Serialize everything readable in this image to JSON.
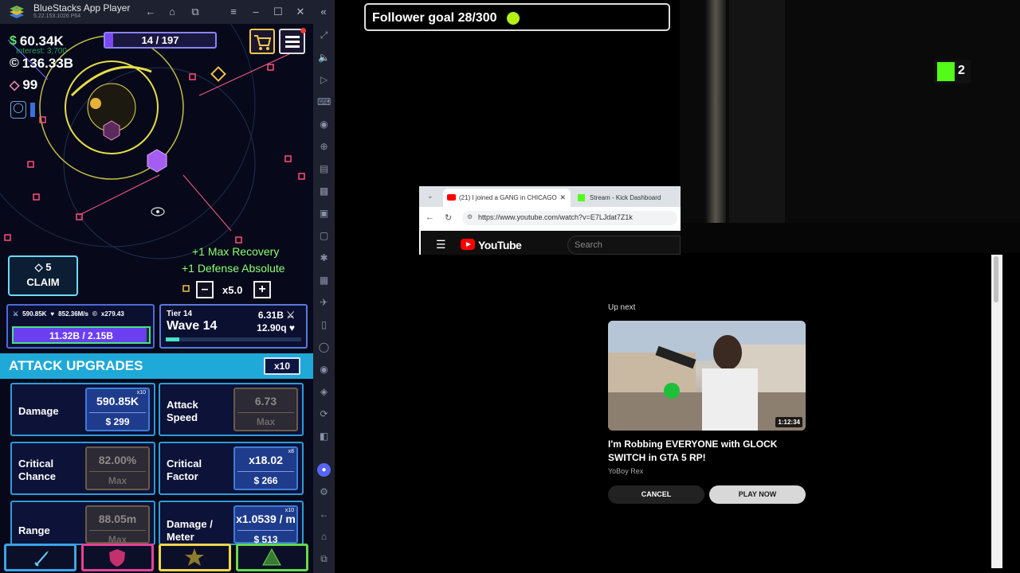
{
  "bluestacks": {
    "title": "BlueStacks App Player",
    "version": "5.22.153.1026  P64",
    "sidebar_icons": [
      "expand-icon",
      "volume-icon",
      "media-icon",
      "keyboard-icon",
      "record-icon",
      "location-icon",
      "performance-icon",
      "folder-icon",
      "screenshot-icon",
      "fullscreen-icon",
      "macro-icon",
      "gallery-icon",
      "flight-icon",
      "multi-instance-icon",
      "eco-icon",
      "location-pin-icon",
      "layers-icon",
      "sync-icon",
      "sidebar-toggle-icon",
      "discord-icon",
      "settings-icon",
      "back-icon",
      "home-icon",
      "recents-icon"
    ]
  },
  "game": {
    "cash": "60.34K",
    "interest": "Interest: 3,700",
    "coins": "136.33B",
    "gems": "99",
    "wave_progress_label": "14 / 197",
    "wave_progress_fraction": 0.07,
    "float_messages": [
      "+1 Max Recovery",
      "+1 Defense Absolute"
    ],
    "claim": {
      "gems": "5",
      "label": "CLAIM"
    },
    "speed": "x5.0",
    "tower_stats": {
      "damage": "590.85K",
      "regen": "852.36M/s",
      "coin_mult": "x279.43",
      "health": "11.32B / 2.15B",
      "health_fraction": 0.98
    },
    "wave_info": {
      "tier": "Tier 14",
      "wave": "Wave 14",
      "enemy_damage": "6.31B",
      "enemy_health": "12.90q",
      "progress_fraction": 0.1
    },
    "upgrades": {
      "header": "ATTACK UPGRADES",
      "multiplier_button": "x10",
      "items": [
        {
          "name": "Damage",
          "value": "590.85K",
          "cost": "$ 299",
          "mult": "x10",
          "maxed": false
        },
        {
          "name": "Attack Speed",
          "value": "6.73",
          "cost": "Max",
          "mult": "",
          "maxed": true
        },
        {
          "name": "Critical Chance",
          "value": "82.00%",
          "cost": "Max",
          "mult": "",
          "maxed": true
        },
        {
          "name": "Critical Factor",
          "value": "x18.02",
          "cost": "$ 266",
          "mult": "x8",
          "maxed": false
        },
        {
          "name": "Range",
          "value": "88.05m",
          "cost": "Max",
          "mult": "",
          "maxed": true
        },
        {
          "name": "Damage / Meter",
          "value": "x1.0539 / m",
          "cost": "$ 513",
          "mult": "x10",
          "maxed": false
        }
      ]
    },
    "bottom_tabs": [
      "attack-tab",
      "defense-tab",
      "utility-tab",
      "ultimate-tab"
    ],
    "colors": {
      "attack": "#3aa3e8",
      "defense": "#e6419a",
      "utility": "#f0d84a",
      "ultimate": "#63d948"
    }
  },
  "stream": {
    "follower_goal": "Follower goal 28/300",
    "follower_fraction": 0.093,
    "kick_viewers": "2"
  },
  "browser": {
    "tab1": "(21) I joined a GANG in CHICAGO",
    "tab2": "Stream - Kick Dashboard",
    "url": "https://www.youtube.com/watch?v=E7LJdat7Z1k",
    "youtube_logo": "YouTube",
    "search_placeholder": "Search"
  },
  "player": {
    "up_next": "Up next",
    "duration": "1:12:34",
    "video_title": "I'm Robbing EVERYONE with GLOCK SWITCH in GTA 5 RP!",
    "channel": "YoBoy Rex",
    "cancel": "CANCEL",
    "play_now": "PLAY NOW"
  }
}
